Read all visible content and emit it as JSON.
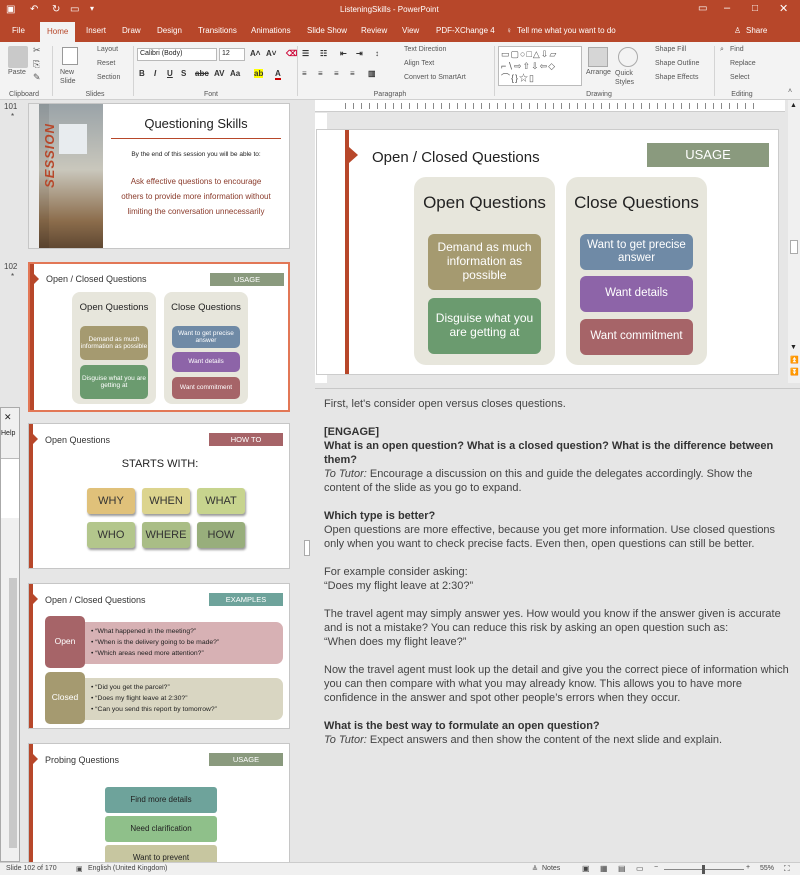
{
  "titlebar": {
    "title": "ListeningSkills  -  PowerPoint"
  },
  "tabs": [
    "File",
    "Home",
    "Insert",
    "Draw",
    "Design",
    "Transitions",
    "Animations",
    "Slide Show",
    "Review",
    "View",
    "PDF-XChange 4"
  ],
  "tell_me": "Tell me what you want to do",
  "share": "Share",
  "ribbon": {
    "paste": "Paste",
    "new_slide": "New Slide",
    "layout": "Layout",
    "reset": "Reset",
    "section": "Section",
    "font_name": "Calibri (Body)",
    "font_size": "12",
    "text_direction": "Text Direction",
    "align_text": "Align Text",
    "convert_smartart": "Convert to SmartArt",
    "arrange": "Arrange",
    "quick_styles": "Quick Styles",
    "shape_fill": "Shape Fill",
    "shape_outline": "Shape Outline",
    "shape_effects": "Shape Effects",
    "find": "Find",
    "replace": "Replace",
    "select": "Select",
    "groups": {
      "clipboard": "Clipboard",
      "slides": "Slides",
      "font": "Font",
      "paragraph": "Paragraph",
      "drawing": "Drawing",
      "editing": "Editing"
    }
  },
  "float_window": {
    "close": "✕",
    "help": "Help"
  },
  "thumbs": {
    "s101": {
      "num": "101",
      "vertical": "SESSION",
      "title": "Questioning Skills",
      "subtitle": "By the end of this session you will be able to:",
      "body": "Ask effective questions to encourage others to provide more information without limiting the conversation unnecessarily"
    },
    "s102": {
      "num": "102",
      "title": "Open / Closed Questions",
      "tag": "USAGE",
      "open_h": "Open Questions",
      "close_h": "Close Questions",
      "o1": "Demand as much information as possible",
      "o2": "Disguise what you are getting at",
      "c1": "Want to get precise answer",
      "c2": "Want details",
      "c3": "Want commitment"
    },
    "s103": {
      "title": "Open Questions",
      "tag": "HOW TO",
      "starts": "STARTS WITH:",
      "words": [
        "WHY",
        "WHEN",
        "WHAT",
        "WHO",
        "WHERE",
        "HOW"
      ]
    },
    "s104": {
      "title": "Open / Closed Questions",
      "tag": "EXAMPLES",
      "open": "Open",
      "closed": "Closed",
      "open_items": [
        "“What happened in the meeting?”",
        "“When is the delivery going to be made?”",
        "“Which areas need more attention?”"
      ],
      "closed_items": [
        "“Did you get the parcel?”",
        "“Does my flight leave at 2:30?”",
        "“Can you send this report by tomorrow?”"
      ]
    },
    "s105": {
      "title": "Probing Questions",
      "tag": "USAGE",
      "items": [
        "Find more details",
        "Need clarification",
        "Want to prevent"
      ]
    }
  },
  "main": {
    "title": "Open / Closed Questions",
    "tag": "USAGE",
    "open_h": "Open Questions",
    "close_h": "Close Questions",
    "o1": "Demand as much information as possible",
    "o2": "Disguise what you are getting at",
    "c1": "Want to get precise answer",
    "c2": "Want details",
    "c3": "Want commitment"
  },
  "notes": {
    "p1": "First, let's consider open versus closes questions.",
    "engage": "[ENGAGE]",
    "q1": "What is an open question? What is a closed question? What is the difference between them?",
    "tutor_label": "To Tutor:",
    "t1": " Encourage a discussion on this and guide the delegates accordingly. Show the content of the slide as you go to expand.",
    "q2": "Which type is better?",
    "p2": "Open questions are more effective, because you get more information. Use closed questions only when you want to check precise facts. Even then, open questions can still be better.",
    "p3a": "For example consider asking:",
    "p3b": "“Does my flight leave at 2:30?”",
    "p4a": "The travel agent may simply answer yes. How would you know if the answer given is accurate and is not a mistake? You can reduce this risk by asking an open question such as:",
    "p4b": "“When does my flight leave?”",
    "p5": "Now the travel agent must look up the detail and give you the correct piece of information which you can then compare with what you may already know. This allows you to have more confidence in the answer and spot other people’s errors when they occur.",
    "q3": "What is the best way to formulate an open question?",
    "t2": " Expect answers and then show the content of the next slide and explain."
  },
  "status": {
    "slide": "Slide 102 of 170",
    "lang": "English (United Kingdom)",
    "notes": "Notes",
    "zoom": "55%"
  },
  "colors": {
    "accent": "#b7472a",
    "tag": "#8a9a7e",
    "khaki": "#a59a70",
    "green": "#6b9b6f",
    "blue": "#6f8aa6",
    "purple": "#8d64a8",
    "maroon": "#a66468"
  }
}
